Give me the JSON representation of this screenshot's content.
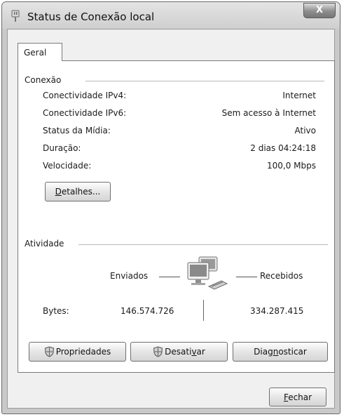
{
  "window": {
    "title": "Status de Conexão local",
    "close_label": "X"
  },
  "tabs": [
    {
      "label": "Geral"
    }
  ],
  "connection": {
    "title": "Conexão",
    "rows": [
      {
        "label": "Conectividade IPv4:",
        "value": "Internet"
      },
      {
        "label": "Conectividade IPv6:",
        "value": "Sem acesso à Internet"
      },
      {
        "label": "Status da Mídia:",
        "value": "Ativo"
      },
      {
        "label": "Duração:",
        "value": "2 dias 04:24:18"
      },
      {
        "label": "Velocidade:",
        "value": "100,0 Mbps"
      }
    ],
    "details_button": {
      "accel": "D",
      "rest": "etalhes..."
    }
  },
  "activity": {
    "title": "Atividade",
    "sent_label": "Enviados",
    "received_label": "Recebidos",
    "bytes_label": "Bytes:",
    "bytes_sent": "146.574.726",
    "bytes_received": "334.287.415",
    "network_icon": "network-computers-icon"
  },
  "buttons": {
    "properties": "Propriedades",
    "disable": {
      "pre": "Desati",
      "accel": "v",
      "post": "ar"
    },
    "diagnose": {
      "pre": "Diag",
      "accel": "n",
      "post": "osticar"
    },
    "close": {
      "accel": "F",
      "rest": "echar"
    }
  }
}
